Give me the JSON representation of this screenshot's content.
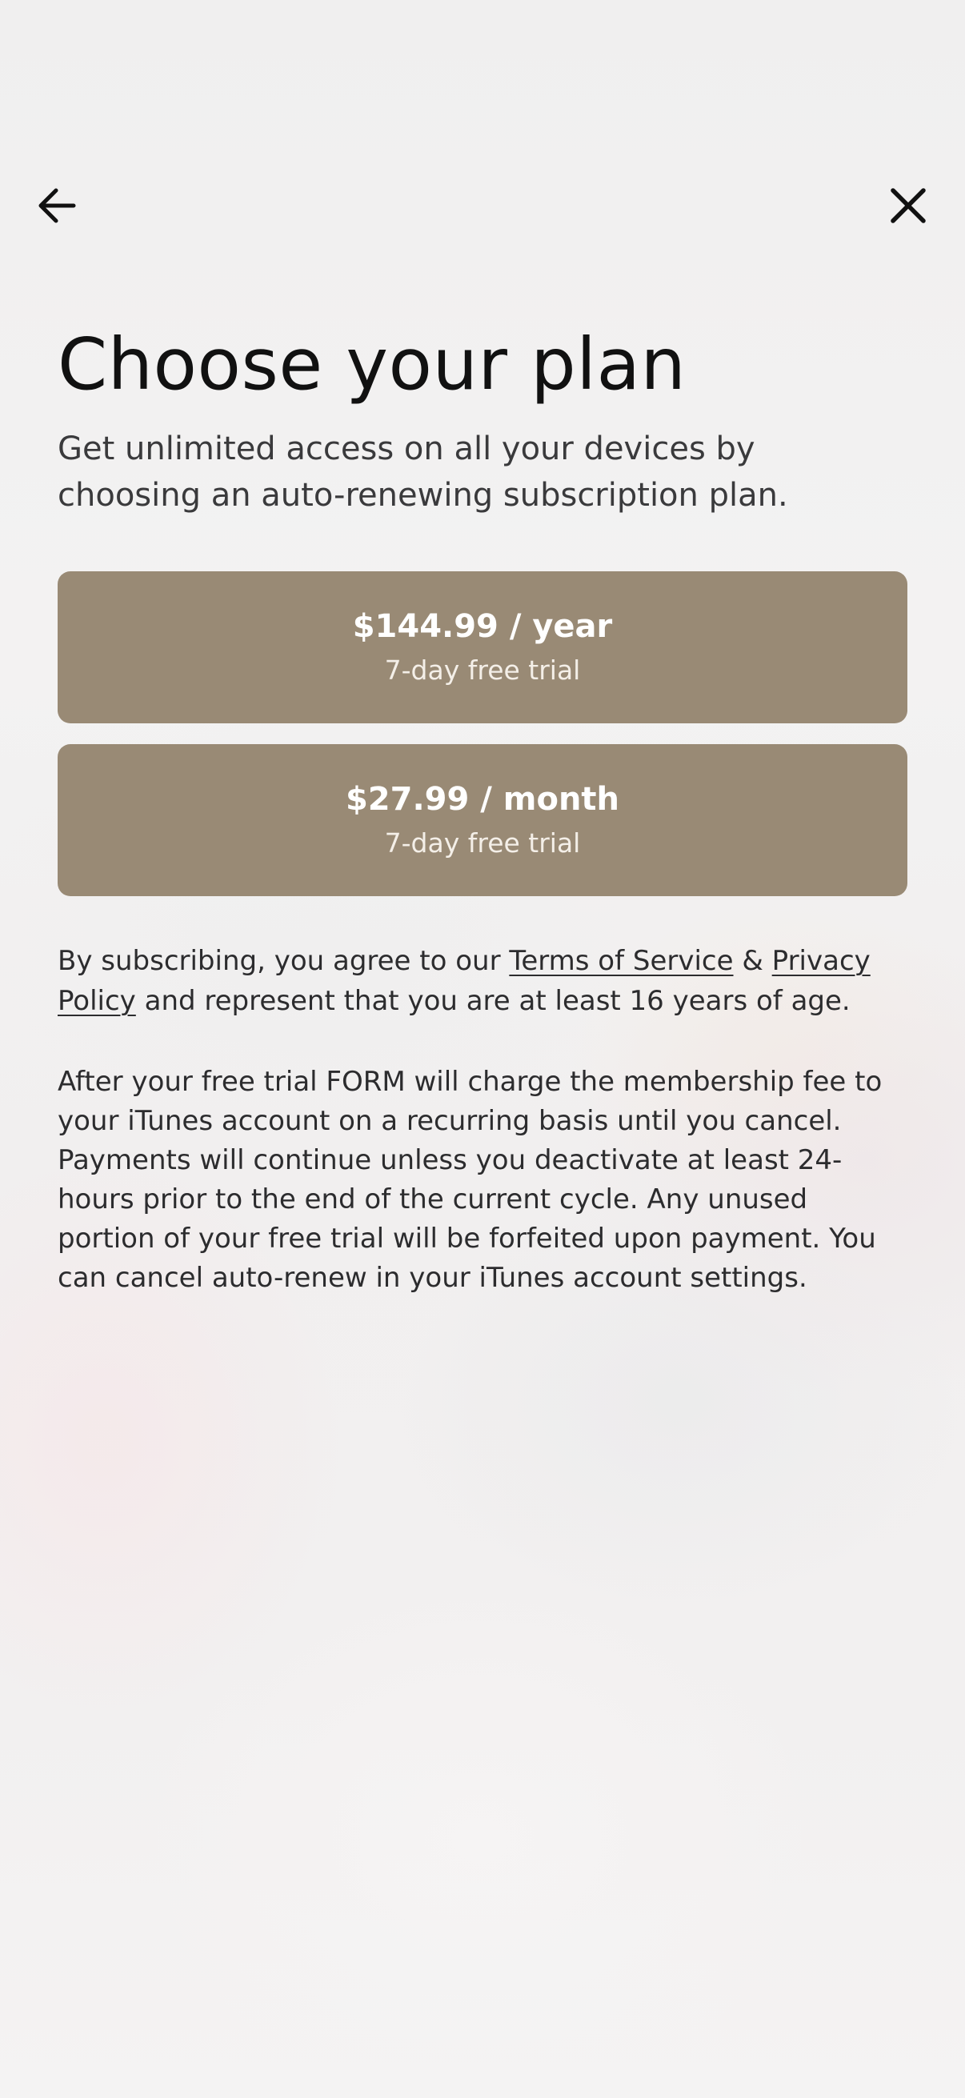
{
  "navigation": {
    "back_icon": "arrow-left-icon",
    "close_icon": "close-icon"
  },
  "header": {
    "title": "Choose your plan",
    "subtitle": "Get unlimited access on all your devices by choosing an auto-renewing subscription plan."
  },
  "plans": [
    {
      "price": "$144.99 / year",
      "trial": "7-day free trial"
    },
    {
      "price": "$27.99 / month",
      "trial": "7-day free trial"
    }
  ],
  "legal": {
    "prefix": "By subscribing, you agree to our ",
    "terms_link": "Terms of Service",
    "ampersand": " & ",
    "privacy_link": "Privacy Policy",
    "suffix": " and represent that you are at least 16 years of age."
  },
  "terms_text": "After your free trial FORM will charge the membership fee to your iTunes account on a recurring basis until you cancel. Payments will continue unless you deactivate at least 24-hours prior to the end of the current cycle. Any unused portion of your free trial will be forfeited upon payment. You can cancel auto-renew in your iTunes account settings.",
  "colors": {
    "plan_button": "#998a75",
    "plan_text": "#ffffff",
    "background": "#f1f0f0"
  }
}
